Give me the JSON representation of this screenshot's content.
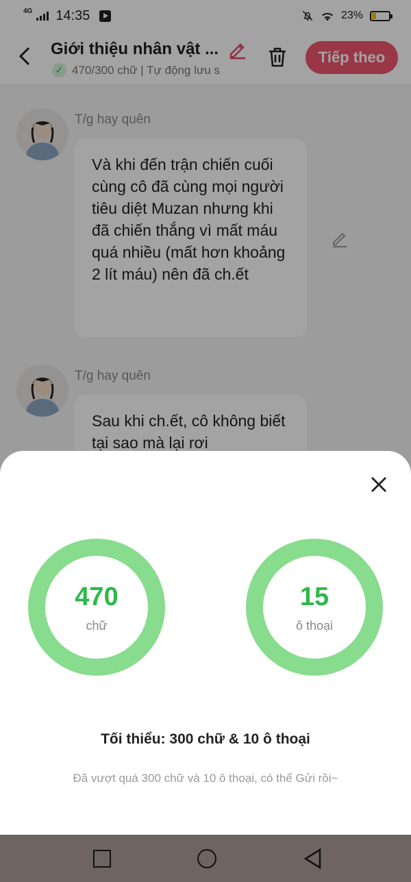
{
  "status_bar": {
    "network": "4G",
    "time": "14:35",
    "battery": "23%",
    "battery_level": 0.23
  },
  "header": {
    "title": "Giới thiệu nhân vật ...",
    "subtitle": "470/300 chữ | Tự động lưu s",
    "next_label": "Tiếp theo"
  },
  "messages": [
    {
      "author": "T/g hay quên",
      "text": "Và khi đến trận chiến cuối cùng cô đã cùng mọi người tiêu diệt Muzan nhưng khi đã chiến thắng vì mất máu quá nhiều (mất hơn khoảng 2 lít máu) nên đã ch.ết"
    },
    {
      "author": "T/g hay quên",
      "text": "Sau khi ch.ết, cô không biết tại sao mà lại rơi"
    }
  ],
  "sheet": {
    "words": {
      "value": "470",
      "label": "chữ"
    },
    "dialogs": {
      "value": "15",
      "label": "ô thoại"
    },
    "minimum": "Tối thiểu: 300 chữ & 10 ô thoại",
    "hint": "Đã vượt quá 300 chữ và 10 ô thoại, có thể Gửi rồi~"
  },
  "colors": {
    "accent": "#f0566f",
    "ring": "#87dc8d",
    "ring_text": "#2fb84a"
  }
}
